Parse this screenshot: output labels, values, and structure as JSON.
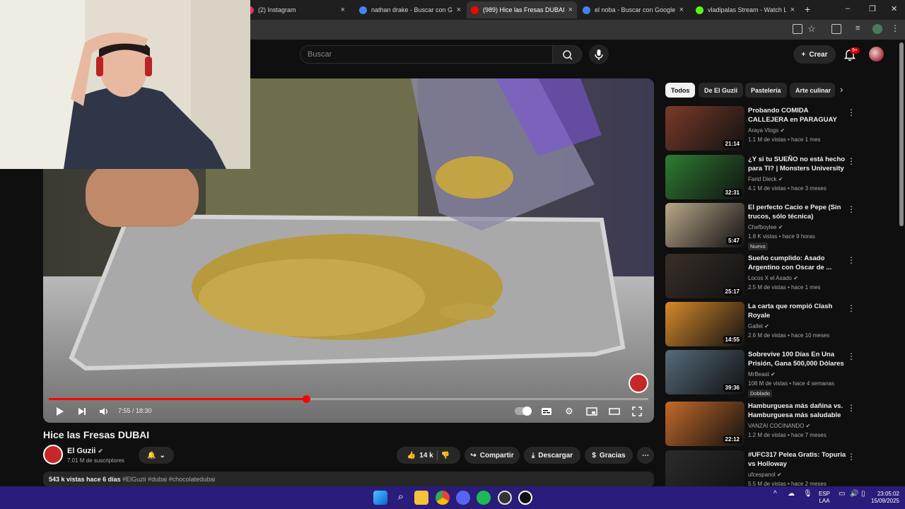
{
  "browser": {
    "tabs": [
      {
        "label": "(2) Instagram",
        "color": "#e1306c"
      },
      {
        "label": "nathan drake - Buscar con Goo",
        "color": "#4285f4"
      },
      {
        "label": "(989) Hice las Fresas DUBAI",
        "color": "#ff0000",
        "active": true
      },
      {
        "label": "el noba - Buscar con Google",
        "color": "#4285f4"
      },
      {
        "label": "vladipalas Stream - Watch Live",
        "color": "#53fc18"
      }
    ],
    "new_tab": "+",
    "window_controls": [
      "–",
      "❐",
      "✕"
    ]
  },
  "header": {
    "search_placeholder": "Buscar",
    "create_label": "Crear",
    "notifications_badge": "9+"
  },
  "player": {
    "time": "7:55 / 18:30",
    "progress_fraction": 0.429
  },
  "video": {
    "title": "Hice las Fresas DUBAI",
    "channel": "El Guzii",
    "subscribers": "7.01 M de suscriptores",
    "likes": "14 k",
    "share_label": "Compartir",
    "download_label": "Descargar",
    "thanks_label": "Gracias",
    "views": "543 k vistas",
    "age": "hace 6 días",
    "hashtags": "#ElGuzii #dubai #chocolatedubai"
  },
  "chips": [
    "Todos",
    "De El Guzii",
    "Pastelería",
    "Arte culinar"
  ],
  "recommendations": [
    {
      "title": "Probando COMIDA CALLEJERA en PARAGUAY 🇵🇾",
      "channel": "Araya Vlogs",
      "meta": "1.1 M de vistas • hace 1 mes",
      "duration": "21:14",
      "tag": "",
      "color": "#7a3b2a"
    },
    {
      "title": "¿Y si tu SUEÑO no está hecho para TI? | Monsters University ...",
      "channel": "Farid Dieck",
      "meta": "4.1 M de vistas • hace 3 meses",
      "duration": "32:31",
      "tag": "",
      "color": "#2e7d32"
    },
    {
      "title": "El perfecto Cacio e Pepe (Sin trucos, sólo técnica)",
      "channel": "Chefboylee",
      "meta": "1.8 K vistas • hace 9 horas",
      "duration": "5:47",
      "tag": "Nuevo",
      "color": "#b9a88a"
    },
    {
      "title": "Sueño cumplido: Asado Argentino con Oscar de ...",
      "channel": "Locos X el Asado",
      "meta": "2.5 M de vistas • hace 1 mes",
      "duration": "25:17",
      "tag": "",
      "color": "#3a2f28"
    },
    {
      "title": "La carta que rompió Clash Royale",
      "channel": "Gallet",
      "meta": "2.6 M de vistas • hace 10 meses",
      "duration": "14:55",
      "tag": "",
      "color": "#d68a2a"
    },
    {
      "title": "Sobrevive 100 Días En Una Prisión, Gana 500,000 Dólares",
      "channel": "MrBeast",
      "meta": "108 M de vistas • hace 4 semanas",
      "duration": "39:36",
      "tag": "Doblado",
      "color": "#556b7a"
    },
    {
      "title": "Hamburguesa más dañina vs. Hamburguesa más saludable",
      "channel": "VANZAI COCINANDO",
      "meta": "1.2 M de vistas • hace 7 meses",
      "duration": "22:12",
      "tag": "",
      "color": "#c46a2a"
    },
    {
      "title": "#UFC317 Pelea Gratis: Topuria vs Holloway",
      "channel": "ufcespanol",
      "meta": "5.5 M de vistas • hace 2 meses",
      "duration": "",
      "tag": "",
      "color": "#2b2b2b"
    }
  ],
  "taskbar": {
    "lang": "ESP",
    "lang2": "LAA",
    "time": "23:05:02",
    "date": "15/09/2025"
  }
}
